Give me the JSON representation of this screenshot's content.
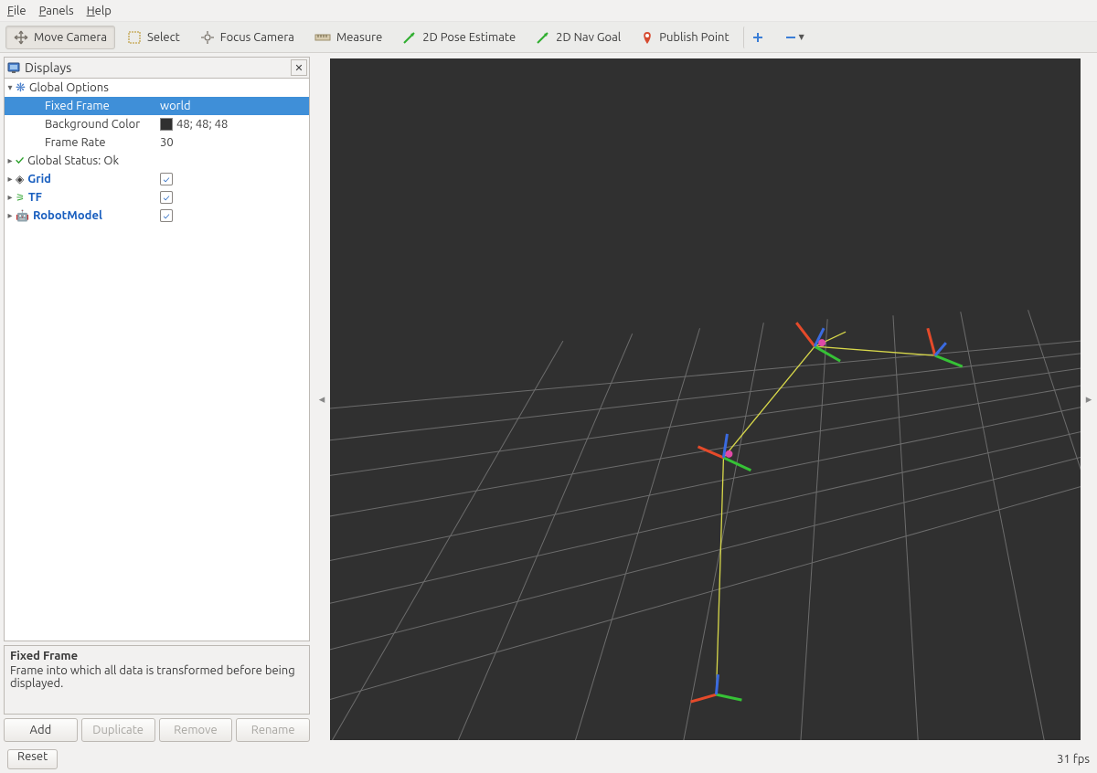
{
  "menubar": {
    "file": "File",
    "panels": "Panels",
    "help": "Help"
  },
  "toolbar": {
    "move_camera": "Move Camera",
    "select": "Select",
    "focus_camera": "Focus Camera",
    "measure": "Measure",
    "pose_estimate": "2D Pose Estimate",
    "nav_goal": "2D Nav Goal",
    "publish_point": "Publish Point"
  },
  "displays": {
    "title": "Displays",
    "global_options": "Global Options",
    "fixed_frame": {
      "label": "Fixed Frame",
      "value": "world"
    },
    "background_color": {
      "label": "Background Color",
      "value": "48; 48; 48"
    },
    "frame_rate": {
      "label": "Frame Rate",
      "value": "30"
    },
    "global_status": "Global Status: Ok",
    "grid": "Grid",
    "tf": "TF",
    "robot_model": "RobotModel"
  },
  "description": {
    "title": "Fixed Frame",
    "body": "Frame into which all data is transformed before being displayed."
  },
  "buttons": {
    "add": "Add",
    "duplicate": "Duplicate",
    "remove": "Remove",
    "rename": "Rename"
  },
  "status": {
    "reset": "Reset",
    "fps": "31 fps"
  }
}
